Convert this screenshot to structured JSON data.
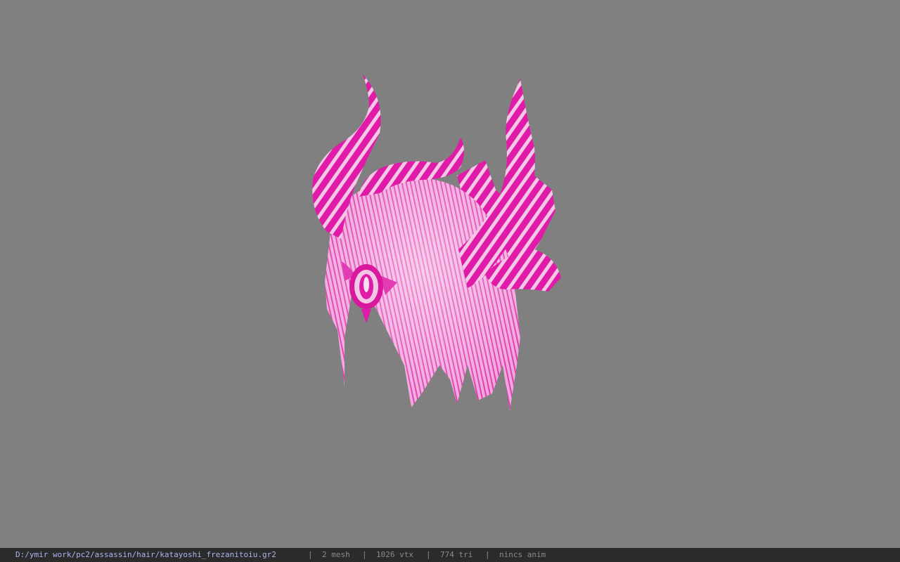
{
  "viewer": {
    "background_color": "#808080",
    "model_icon": "demon-horned-hair-model",
    "model_colors": {
      "primary": "#e01ba8",
      "highlight": "#f5d4ec",
      "shadow": "#a1006f"
    }
  },
  "status_bar": {
    "file_path": "D:/ymir work/pc2/assassin/hair/katayoshi_frezanitoiu.gr2",
    "separator": "|",
    "mesh_count": "2 mesh",
    "vertex_count": "1026 vtx",
    "triangle_count": "774 tri",
    "animation_status": "nincs anim"
  }
}
